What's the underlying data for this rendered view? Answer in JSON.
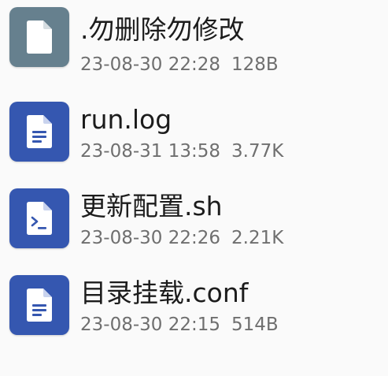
{
  "files": [
    {
      "name": ".勿删除勿修改",
      "date": "23-08-30 22:28",
      "size": "128B",
      "icon": "blank-file-icon",
      "icon_color": "#66808e"
    },
    {
      "name": "run.log",
      "date": "23-08-31 13:58",
      "size": "3.77K",
      "icon": "text-document-icon",
      "icon_color": "#3557b0"
    },
    {
      "name": "更新配置.sh",
      "date": "23-08-30 22:26",
      "size": "2.21K",
      "icon": "terminal-script-icon",
      "icon_color": "#3557b0"
    },
    {
      "name": "目录挂载.conf",
      "date": "23-08-30 22:15",
      "size": "514B",
      "icon": "text-document-icon",
      "icon_color": "#3557b0"
    }
  ]
}
